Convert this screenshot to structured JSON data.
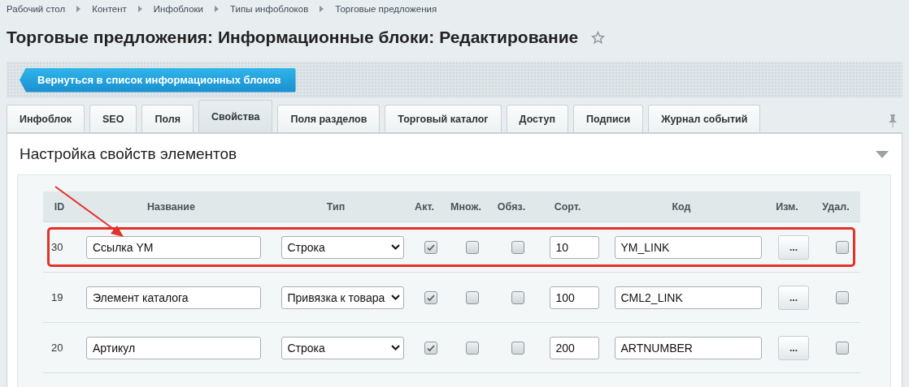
{
  "breadcrumbs": [
    "Рабочий стол",
    "Контент",
    "Инфоблоки",
    "Типы инфоблоков",
    "Торговые предложения"
  ],
  "title": "Торговые предложения: Информационные блоки: Редактирование",
  "back_button": "Вернуться в список информационных блоков",
  "tabs": [
    {
      "label": "Инфоблок",
      "selected": false
    },
    {
      "label": "SEO",
      "selected": false
    },
    {
      "label": "Поля",
      "selected": false
    },
    {
      "label": "Свойства",
      "selected": true
    },
    {
      "label": "Поля разделов",
      "selected": false
    },
    {
      "label": "Торговый каталог",
      "selected": false
    },
    {
      "label": "Доступ",
      "selected": false
    },
    {
      "label": "Подписи",
      "selected": false
    },
    {
      "label": "Журнал событий",
      "selected": false
    }
  ],
  "section": {
    "title": "Настройка свойств элементов"
  },
  "table": {
    "columns": [
      "ID",
      "Название",
      "Тип",
      "Акт.",
      "Множ.",
      "Обяз.",
      "Сорт.",
      "Код",
      "Изм.",
      "Удал."
    ],
    "rows": [
      {
        "id": "30",
        "name": "Ссылка YM",
        "type": "Строка",
        "active": true,
        "multiple": false,
        "required": false,
        "sort": "10",
        "code": "YM_LINK",
        "edit": "...",
        "delete": false,
        "highlighted": true
      },
      {
        "id": "19",
        "name": "Элемент каталога",
        "type": "Привязка к товара",
        "active": true,
        "multiple": false,
        "required": false,
        "sort": "100",
        "code": "CML2_LINK",
        "edit": "...",
        "delete": false,
        "highlighted": false
      },
      {
        "id": "20",
        "name": "Артикул",
        "type": "Строка",
        "active": true,
        "multiple": false,
        "required": false,
        "sort": "200",
        "code": "ARTNUMBER",
        "edit": "...",
        "delete": false,
        "highlighted": false
      }
    ]
  }
}
